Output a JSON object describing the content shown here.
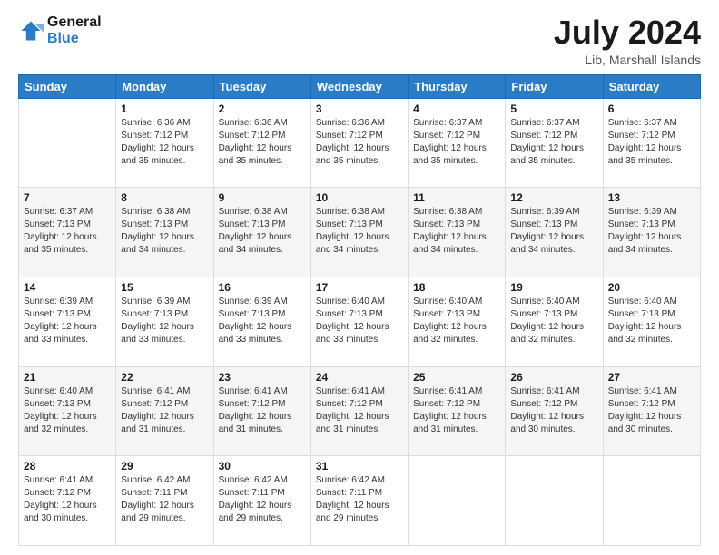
{
  "header": {
    "logo_line1": "General",
    "logo_line2": "Blue",
    "month": "July 2024",
    "location": "Lib, Marshall Islands"
  },
  "weekdays": [
    "Sunday",
    "Monday",
    "Tuesday",
    "Wednesday",
    "Thursday",
    "Friday",
    "Saturday"
  ],
  "weeks": [
    [
      {
        "day": "",
        "sunrise": "",
        "sunset": "",
        "daylight": ""
      },
      {
        "day": "1",
        "sunrise": "Sunrise: 6:36 AM",
        "sunset": "Sunset: 7:12 PM",
        "daylight": "Daylight: 12 hours and 35 minutes."
      },
      {
        "day": "2",
        "sunrise": "Sunrise: 6:36 AM",
        "sunset": "Sunset: 7:12 PM",
        "daylight": "Daylight: 12 hours and 35 minutes."
      },
      {
        "day": "3",
        "sunrise": "Sunrise: 6:36 AM",
        "sunset": "Sunset: 7:12 PM",
        "daylight": "Daylight: 12 hours and 35 minutes."
      },
      {
        "day": "4",
        "sunrise": "Sunrise: 6:37 AM",
        "sunset": "Sunset: 7:12 PM",
        "daylight": "Daylight: 12 hours and 35 minutes."
      },
      {
        "day": "5",
        "sunrise": "Sunrise: 6:37 AM",
        "sunset": "Sunset: 7:12 PM",
        "daylight": "Daylight: 12 hours and 35 minutes."
      },
      {
        "day": "6",
        "sunrise": "Sunrise: 6:37 AM",
        "sunset": "Sunset: 7:12 PM",
        "daylight": "Daylight: 12 hours and 35 minutes."
      }
    ],
    [
      {
        "day": "7",
        "sunrise": "Sunrise: 6:37 AM",
        "sunset": "Sunset: 7:13 PM",
        "daylight": "Daylight: 12 hours and 35 minutes."
      },
      {
        "day": "8",
        "sunrise": "Sunrise: 6:38 AM",
        "sunset": "Sunset: 7:13 PM",
        "daylight": "Daylight: 12 hours and 34 minutes."
      },
      {
        "day": "9",
        "sunrise": "Sunrise: 6:38 AM",
        "sunset": "Sunset: 7:13 PM",
        "daylight": "Daylight: 12 hours and 34 minutes."
      },
      {
        "day": "10",
        "sunrise": "Sunrise: 6:38 AM",
        "sunset": "Sunset: 7:13 PM",
        "daylight": "Daylight: 12 hours and 34 minutes."
      },
      {
        "day": "11",
        "sunrise": "Sunrise: 6:38 AM",
        "sunset": "Sunset: 7:13 PM",
        "daylight": "Daylight: 12 hours and 34 minutes."
      },
      {
        "day": "12",
        "sunrise": "Sunrise: 6:39 AM",
        "sunset": "Sunset: 7:13 PM",
        "daylight": "Daylight: 12 hours and 34 minutes."
      },
      {
        "day": "13",
        "sunrise": "Sunrise: 6:39 AM",
        "sunset": "Sunset: 7:13 PM",
        "daylight": "Daylight: 12 hours and 34 minutes."
      }
    ],
    [
      {
        "day": "14",
        "sunrise": "Sunrise: 6:39 AM",
        "sunset": "Sunset: 7:13 PM",
        "daylight": "Daylight: 12 hours and 33 minutes."
      },
      {
        "day": "15",
        "sunrise": "Sunrise: 6:39 AM",
        "sunset": "Sunset: 7:13 PM",
        "daylight": "Daylight: 12 hours and 33 minutes."
      },
      {
        "day": "16",
        "sunrise": "Sunrise: 6:39 AM",
        "sunset": "Sunset: 7:13 PM",
        "daylight": "Daylight: 12 hours and 33 minutes."
      },
      {
        "day": "17",
        "sunrise": "Sunrise: 6:40 AM",
        "sunset": "Sunset: 7:13 PM",
        "daylight": "Daylight: 12 hours and 33 minutes."
      },
      {
        "day": "18",
        "sunrise": "Sunrise: 6:40 AM",
        "sunset": "Sunset: 7:13 PM",
        "daylight": "Daylight: 12 hours and 32 minutes."
      },
      {
        "day": "19",
        "sunrise": "Sunrise: 6:40 AM",
        "sunset": "Sunset: 7:13 PM",
        "daylight": "Daylight: 12 hours and 32 minutes."
      },
      {
        "day": "20",
        "sunrise": "Sunrise: 6:40 AM",
        "sunset": "Sunset: 7:13 PM",
        "daylight": "Daylight: 12 hours and 32 minutes."
      }
    ],
    [
      {
        "day": "21",
        "sunrise": "Sunrise: 6:40 AM",
        "sunset": "Sunset: 7:13 PM",
        "daylight": "Daylight: 12 hours and 32 minutes."
      },
      {
        "day": "22",
        "sunrise": "Sunrise: 6:41 AM",
        "sunset": "Sunset: 7:12 PM",
        "daylight": "Daylight: 12 hours and 31 minutes."
      },
      {
        "day": "23",
        "sunrise": "Sunrise: 6:41 AM",
        "sunset": "Sunset: 7:12 PM",
        "daylight": "Daylight: 12 hours and 31 minutes."
      },
      {
        "day": "24",
        "sunrise": "Sunrise: 6:41 AM",
        "sunset": "Sunset: 7:12 PM",
        "daylight": "Daylight: 12 hours and 31 minutes."
      },
      {
        "day": "25",
        "sunrise": "Sunrise: 6:41 AM",
        "sunset": "Sunset: 7:12 PM",
        "daylight": "Daylight: 12 hours and 31 minutes."
      },
      {
        "day": "26",
        "sunrise": "Sunrise: 6:41 AM",
        "sunset": "Sunset: 7:12 PM",
        "daylight": "Daylight: 12 hours and 30 minutes."
      },
      {
        "day": "27",
        "sunrise": "Sunrise: 6:41 AM",
        "sunset": "Sunset: 7:12 PM",
        "daylight": "Daylight: 12 hours and 30 minutes."
      }
    ],
    [
      {
        "day": "28",
        "sunrise": "Sunrise: 6:41 AM",
        "sunset": "Sunset: 7:12 PM",
        "daylight": "Daylight: 12 hours and 30 minutes."
      },
      {
        "day": "29",
        "sunrise": "Sunrise: 6:42 AM",
        "sunset": "Sunset: 7:11 PM",
        "daylight": "Daylight: 12 hours and 29 minutes."
      },
      {
        "day": "30",
        "sunrise": "Sunrise: 6:42 AM",
        "sunset": "Sunset: 7:11 PM",
        "daylight": "Daylight: 12 hours and 29 minutes."
      },
      {
        "day": "31",
        "sunrise": "Sunrise: 6:42 AM",
        "sunset": "Sunset: 7:11 PM",
        "daylight": "Daylight: 12 hours and 29 minutes."
      },
      {
        "day": "",
        "sunrise": "",
        "sunset": "",
        "daylight": ""
      },
      {
        "day": "",
        "sunrise": "",
        "sunset": "",
        "daylight": ""
      },
      {
        "day": "",
        "sunrise": "",
        "sunset": "",
        "daylight": ""
      }
    ]
  ]
}
